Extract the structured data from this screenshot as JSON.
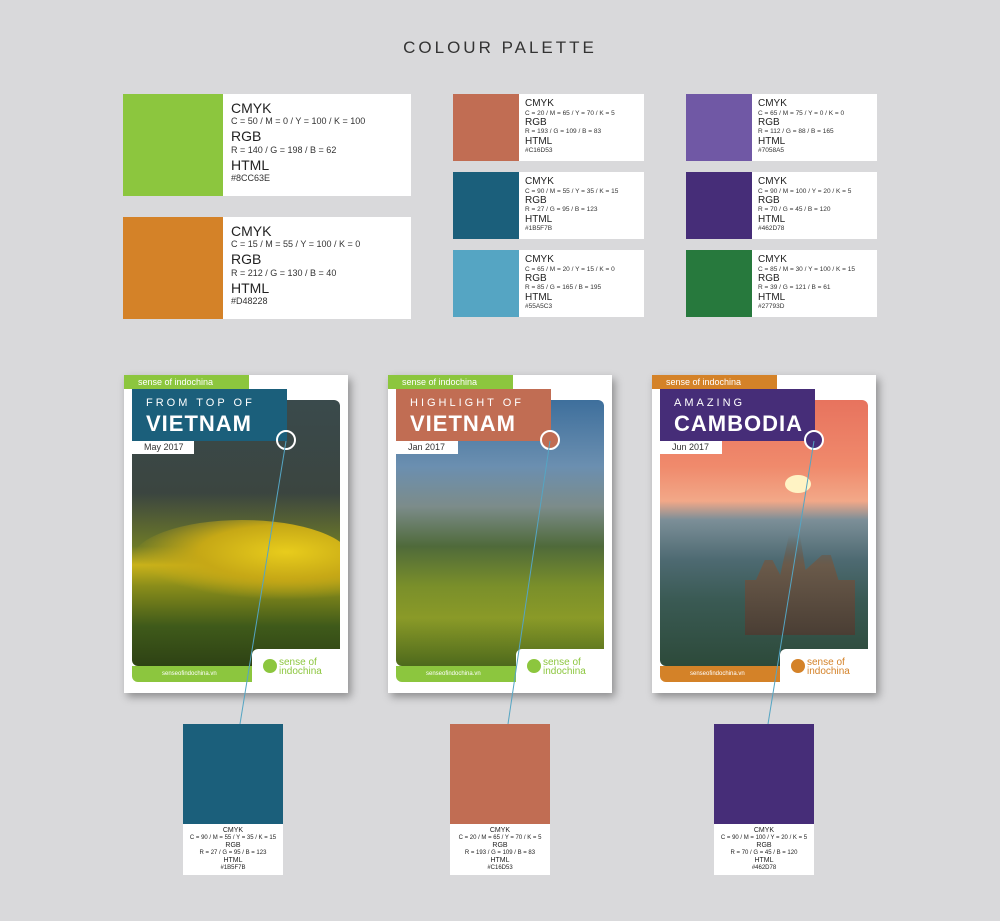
{
  "title": "COLOUR PALETTE",
  "labels": {
    "cmyk": "CMYK",
    "rgb": "RGB",
    "html": "HTML"
  },
  "big_swatches": [
    {
      "color": "#8CC63E",
      "cmyk": "C = 50 / M = 0 / Y = 100 / K = 100",
      "rgb": "R = 140 / G = 198 / B = 62",
      "html": "#8CC63E"
    },
    {
      "color": "#D48228",
      "cmyk": "C = 15 / M = 55 / Y = 100 / K = 0",
      "rgb": "R = 212 / G = 130 / B = 40",
      "html": "#D48228"
    }
  ],
  "small_swatches": [
    {
      "color": "#C16D53",
      "cmyk": "C = 20 / M = 65 / Y = 70 / K = 5",
      "rgb": "R = 193 / G = 109 / B = 83",
      "html": "#C16D53"
    },
    {
      "color": "#1B5F7B",
      "cmyk": "C = 90 / M = 55 / Y = 35 / K = 15",
      "rgb": "R = 27 / G = 95 / B = 123",
      "html": "#1B5F7B"
    },
    {
      "color": "#55A5C3",
      "cmyk": "C = 65 / M = 20 / Y = 15 / K = 0",
      "rgb": "R = 85 / G = 165 / B = 195",
      "html": "#55A5C3"
    },
    {
      "color": "#7058A5",
      "cmyk": "C = 65 / M = 75 / Y = 0 / K = 0",
      "rgb": "R = 112 / G = 88 / B = 165",
      "html": "#7058A5"
    },
    {
      "color": "#462D78",
      "cmyk": "C = 90 / M = 100 / Y = 20 / K = 5",
      "rgb": "R = 70 / G = 45 / B = 120",
      "html": "#462D78"
    },
    {
      "color": "#27793D",
      "cmyk": "C = 85 / M = 30 / Y = 100 / K = 15",
      "rgb": "R = 39 / G = 121 / B = 61",
      "html": "#27793D"
    }
  ],
  "posters": [
    {
      "brand": "sense of indochina",
      "line1": "FROM TOP OF",
      "line2": "VIETNAM",
      "date": "May 2017",
      "footer": "senseofindochina.vn",
      "logo": "sense of indochina",
      "accent": "#1B5F7B",
      "band": "#8CC63E"
    },
    {
      "brand": "sense of indochina",
      "line1": "HIGHLIGHT OF",
      "line2": "VIETNAM",
      "date": "Jan 2017",
      "footer": "senseofindochina.vn",
      "logo": "sense of indochina",
      "accent": "#C16D53",
      "band": "#8CC63E"
    },
    {
      "brand": "sense of indochina",
      "line1": "AMAZING",
      "line2": "CAMBODIA",
      "date": "Jun 2017",
      "footer": "senseofindochina.vn",
      "logo": "sense of indochina",
      "accent": "#462D78",
      "band": "#D48228"
    }
  ],
  "bottom_swatches": [
    {
      "color": "#1B5F7B",
      "cmyk": "C = 90 / M = 55 / Y = 35 / K = 15",
      "rgb": "R = 27 / G = 95 / B = 123",
      "html": "#1B5F7B"
    },
    {
      "color": "#C16D53",
      "cmyk": "C = 20 / M = 65 / Y = 70 / K = 5",
      "rgb": "R = 193 / G = 109 / B = 83",
      "html": "#C16D53"
    },
    {
      "color": "#462D78",
      "cmyk": "C = 90 / M = 100 / Y = 20 / K = 5",
      "rgb": "R = 70 / G = 45 / B = 120",
      "html": "#462D78"
    }
  ]
}
